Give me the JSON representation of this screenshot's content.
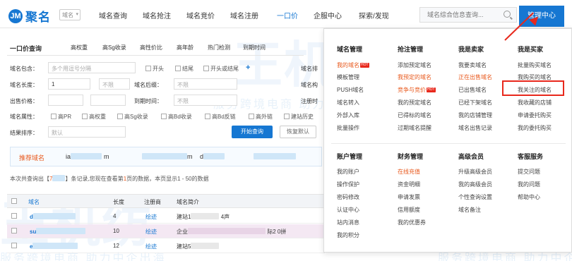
{
  "header": {
    "logo_mark": "JM",
    "logo_text": "聚名",
    "domain_select": "域名",
    "nav": [
      "域名查询",
      "域名抢注",
      "域名竞价",
      "域名注册",
      "一口价",
      "企服中心",
      "探索/发现"
    ],
    "active_nav": "一口价",
    "search_placeholder": "域名综合信息查询...",
    "mgmt_label": "管理中心"
  },
  "query": {
    "title": "一口价查询",
    "subtabs": [
      "高权重",
      "高Sg收录",
      "高性价比",
      "高年龄",
      "热门检测",
      "到期时间"
    ],
    "labels": {
      "keyword": "域名包含：",
      "length": "域名长度：",
      "price": "出售价格：",
      "attr": "域名属性：",
      "sort": "结果排序："
    },
    "keyword_placeholder": "多个用逗号分隔",
    "start_label": "开头",
    "end_label": "结尾",
    "nohead_label": "开头或结尾",
    "plus": "+",
    "length_value": "1",
    "unlimited": "不限",
    "suffix_label": "域名后缀：",
    "expire_label": "到期时间：",
    "sort_value": "默认",
    "attr_checks": [
      "高PR",
      "高权重",
      "高Sg收录",
      "高Bd收录",
      "高Bd反链",
      "高外链",
      "建站历史"
    ],
    "start_btn": "开始查询",
    "reset_btn": "恢复默认",
    "right_cut_1": "域名排",
    "right_cut_2": "域名构",
    "right_cut_3": "注册时"
  },
  "recommend": {
    "label": "推荐域名",
    "items": [
      "ia",
      "m",
      "d"
    ]
  },
  "result": {
    "prefix": "本次共查询出【",
    "count": "7",
    "mid": "】条记录,您现在查看第",
    "page": "1",
    "suffix": "页的数据，本页显示1 - 50的数据"
  },
  "table": {
    "headers": [
      "域名",
      "长度",
      "注册商",
      "域名简介"
    ],
    "rows": [
      {
        "name": "d",
        "length": "4",
        "registrar": "绘迹",
        "intro": "建站1",
        "extra": "4声"
      },
      {
        "name": "su",
        "length": "10",
        "registrar": "绘迹",
        "intro": "企业",
        "extra": "际2 0拼"
      },
      {
        "name": "e",
        "length": "12",
        "registrar": "绘迹",
        "intro": "建站5"
      }
    ]
  },
  "menu": {
    "col1_head": "域名管理",
    "col1_items": [
      "我的域名",
      "模板管理",
      "PUSH域名",
      "域名转入",
      "外部入库",
      "批量操作"
    ],
    "col2_head": "抢注管理",
    "col2_items": [
      "添加预定域名",
      "我预定的域名",
      "竞争与竞价",
      "我的预定域名",
      "已得标的域名",
      "过期域名提醒"
    ],
    "col3_head": "我是卖家",
    "col3_items": [
      "我要卖域名",
      "正在出售域名",
      "已出售域名",
      "已经下架域名",
      "我的店铺管理",
      "域名出售记录"
    ],
    "col4_head": "我是买家",
    "col4_items": [
      "批量购买域名",
      "我购买的域名",
      "我关注的域名",
      "我收藏的店铺",
      "申请委托购买",
      "我的委托购买"
    ],
    "col5_head": "账户管理",
    "col5_items": [
      "我的账户",
      "操作保护",
      "密码修改",
      "认证中心",
      "站内消息",
      "我的积分"
    ],
    "col6_head": "财务管理",
    "col6_items": [
      "在线充值",
      "资金明细",
      "申请发票",
      "信用额度",
      "我的优惠券"
    ],
    "col7_head": "高级会员",
    "col7_items": [
      "升级高级会员",
      "我的高级会员",
      "个性查询设置",
      "域名备注"
    ],
    "col8_head": "客服服务",
    "col8_items": [
      "提交问题",
      "我的问题",
      "帮助中心"
    ],
    "hot": "HOT"
  },
  "watermark": {
    "logo": "王机纺",
    "tagline": "服务跨境电商 助力中企出海"
  }
}
